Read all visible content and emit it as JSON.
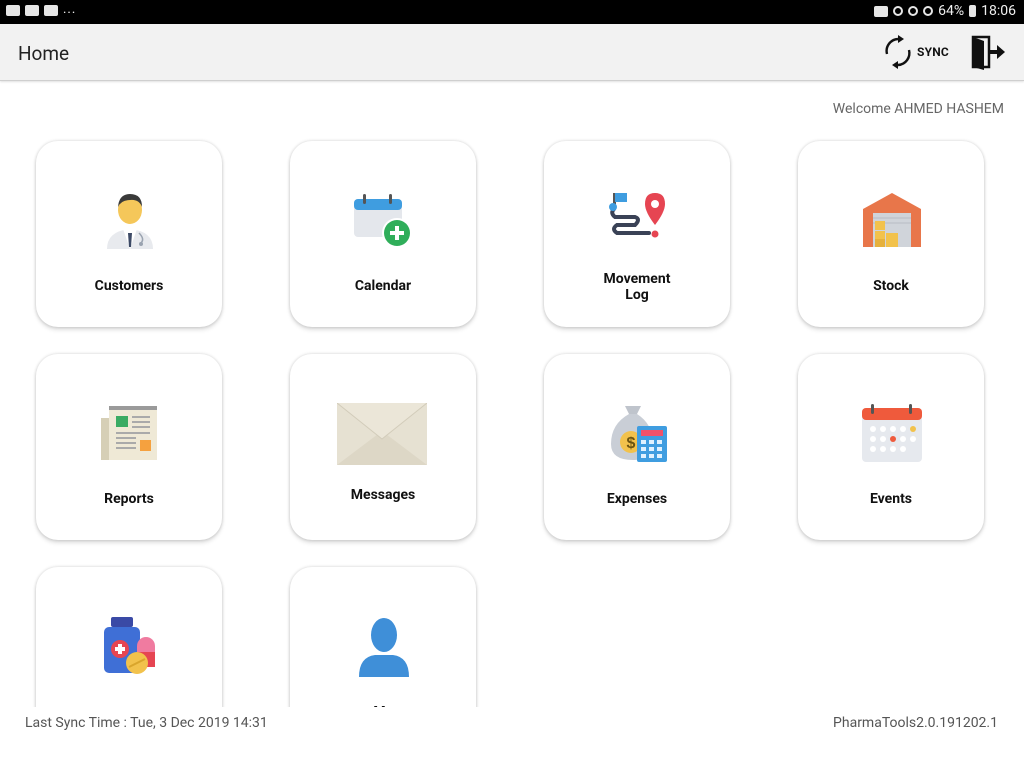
{
  "status_bar": {
    "dots": "...",
    "battery": "64%",
    "time": "18:06"
  },
  "toolbar": {
    "title": "Home",
    "sync_label": "SYNC"
  },
  "welcome": "Welcome AHMED HASHEM",
  "tiles": [
    {
      "label": "Customers",
      "icon": "doctor-icon"
    },
    {
      "label": "Calendar",
      "icon": "calendar-add-icon"
    },
    {
      "label": "Movement\nLog",
      "icon": "route-map-icon"
    },
    {
      "label": "Stock",
      "icon": "warehouse-icon"
    },
    {
      "label": "Reports",
      "icon": "newspaper-icon"
    },
    {
      "label": "Messages",
      "icon": "envelope-icon"
    },
    {
      "label": "Expenses",
      "icon": "money-bag-calculator-icon"
    },
    {
      "label": "Events",
      "icon": "event-calendar-icon"
    },
    {
      "label": "",
      "icon": "medicine-bottle-icon"
    },
    {
      "label": "My",
      "icon": "user-silhouette-icon"
    }
  ],
  "footer": {
    "last_sync": "Last Sync Time :  Tue, 3 Dec 2019 14:31",
    "version": "PharmaTools2.0.191202.1"
  },
  "colors": {
    "toolbar_bg": "#f2f2f2",
    "status_bar_bg": "#000000",
    "tile_bg": "#ffffff"
  }
}
